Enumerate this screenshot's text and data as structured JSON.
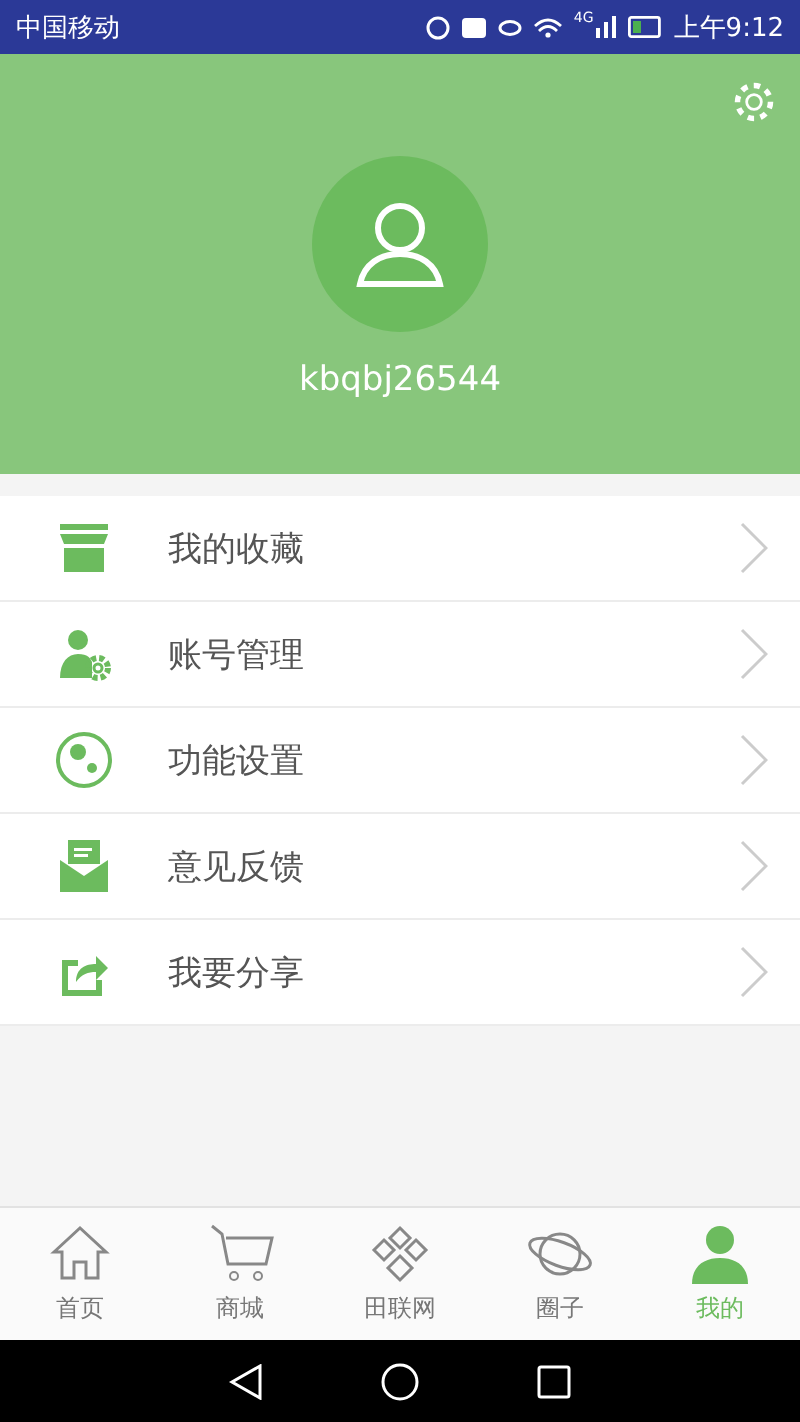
{
  "status_bar": {
    "carrier": "中国移动",
    "network": "4G",
    "time": "上午9:12"
  },
  "profile": {
    "username": "kbqbj26544"
  },
  "menu": [
    {
      "kind": "store",
      "label": "我的收藏"
    },
    {
      "kind": "account",
      "label": "账号管理"
    },
    {
      "kind": "function",
      "label": "功能设置"
    },
    {
      "kind": "mail",
      "label": "意见反馈"
    },
    {
      "kind": "share",
      "label": "我要分享"
    }
  ],
  "tabs": [
    {
      "kind": "home",
      "label": "首页",
      "selected": false
    },
    {
      "kind": "cart",
      "label": "商城",
      "selected": false
    },
    {
      "kind": "field",
      "label": "田联网",
      "selected": false
    },
    {
      "kind": "planet",
      "label": "圈子",
      "selected": false
    },
    {
      "kind": "user",
      "label": "我的",
      "selected": true
    }
  ]
}
